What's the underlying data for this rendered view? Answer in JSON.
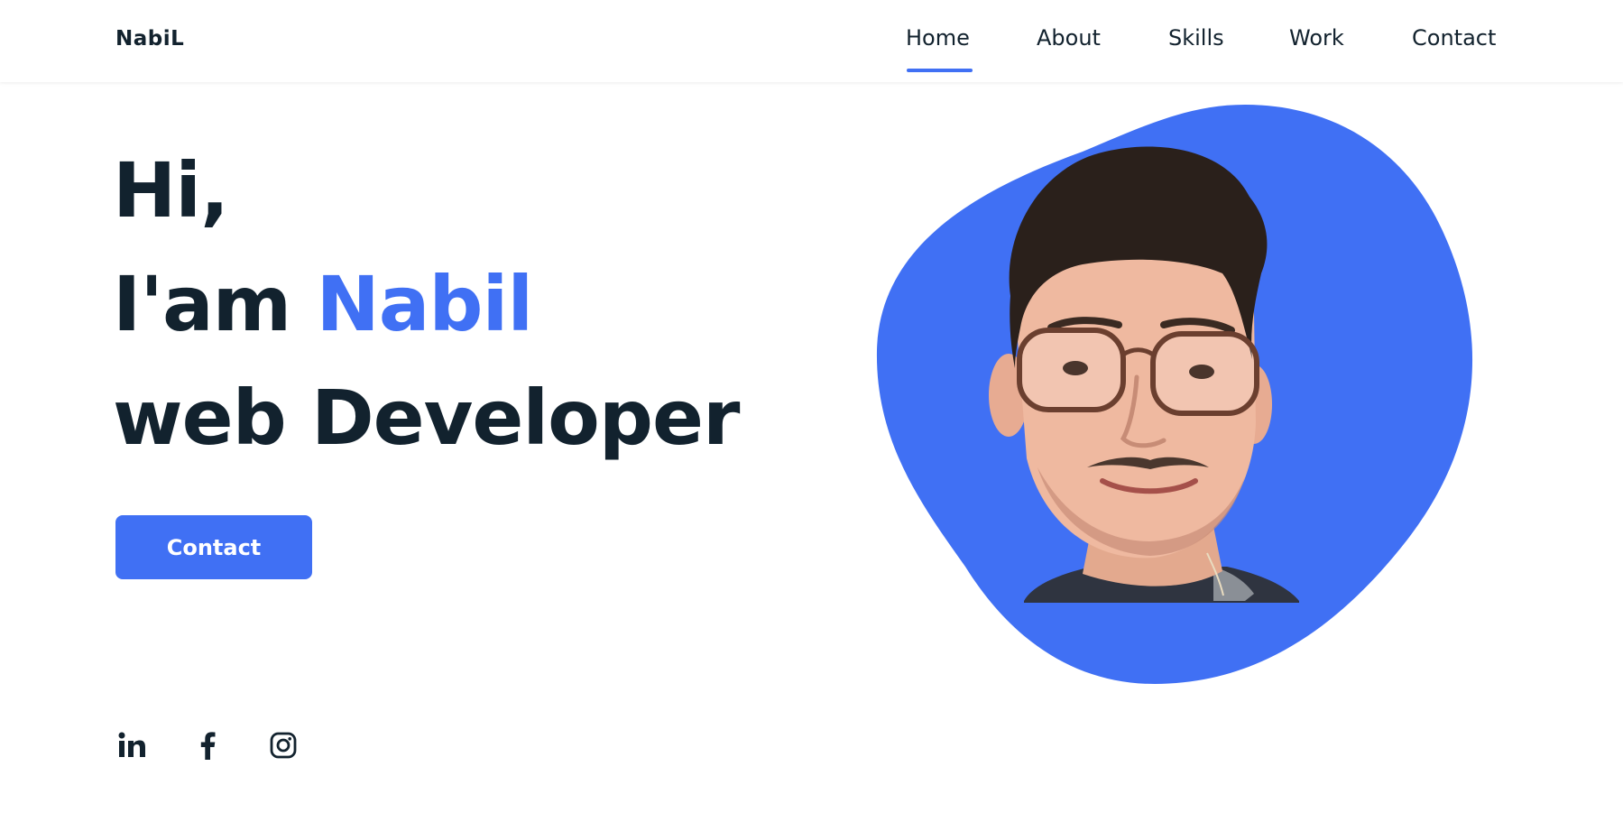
{
  "header": {
    "logo": "NabiL",
    "nav": [
      {
        "label": "Home",
        "active": true
      },
      {
        "label": "About",
        "active": false
      },
      {
        "label": "Skills",
        "active": false
      },
      {
        "label": "Work",
        "active": false
      },
      {
        "label": "Contact",
        "active": false
      }
    ]
  },
  "hero": {
    "line1": "Hi,",
    "line2_prefix": "I'am ",
    "line2_name": "Nabil",
    "line3": "web Developer",
    "cta_label": "Contact"
  },
  "socials": [
    {
      "icon": "linkedin-icon"
    },
    {
      "icon": "facebook-icon"
    },
    {
      "icon": "instagram-icon"
    }
  ],
  "colors": {
    "accent": "#4070f4",
    "text": "#12222e",
    "background": "#ffffff"
  }
}
